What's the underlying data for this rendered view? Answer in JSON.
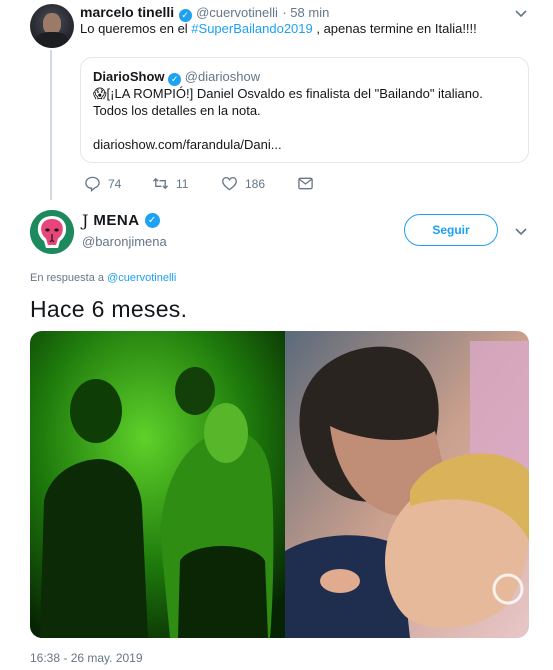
{
  "tweet1": {
    "display_name": "marcelo tinelli",
    "handle": "@cuervotinelli",
    "time": "· 58 min",
    "text_before": "Lo queremos en el ",
    "hashtag": "#SuperBailando2019",
    "text_after": " , apenas termine en Italia!!!!",
    "quote": {
      "display_name": "DiarioShow",
      "handle": "@diarioshow",
      "text": "😱[¡LA ROMPIÓ!] Daniel Osvaldo es finalista del \"Bailando\" italiano. Todos los detalles en la nota.",
      "link": "diarioshow.com/farandula/Dani..."
    },
    "actions": {
      "replies": "74",
      "retweets": "11",
      "likes": "186"
    }
  },
  "tweet2": {
    "display_name_prefix": "J",
    "display_name": "MENA",
    "handle": "@baronjimena",
    "follow_label": "Seguir",
    "reply_prefix": "En respuesta a",
    "reply_handle": "@cuervotinelli",
    "text": "Hace 6 meses.",
    "timestamp": "16:38 - 26 may. 2019"
  },
  "colors": {
    "accent": "#1da1f2",
    "secondary_text": "#657786",
    "border": "#e1e8ed"
  },
  "icons": [
    "chevron-down-icon",
    "verified-badge-icon",
    "reply-icon",
    "retweet-icon",
    "like-icon",
    "direct-message-icon",
    "cobra-avatar-icon"
  ]
}
